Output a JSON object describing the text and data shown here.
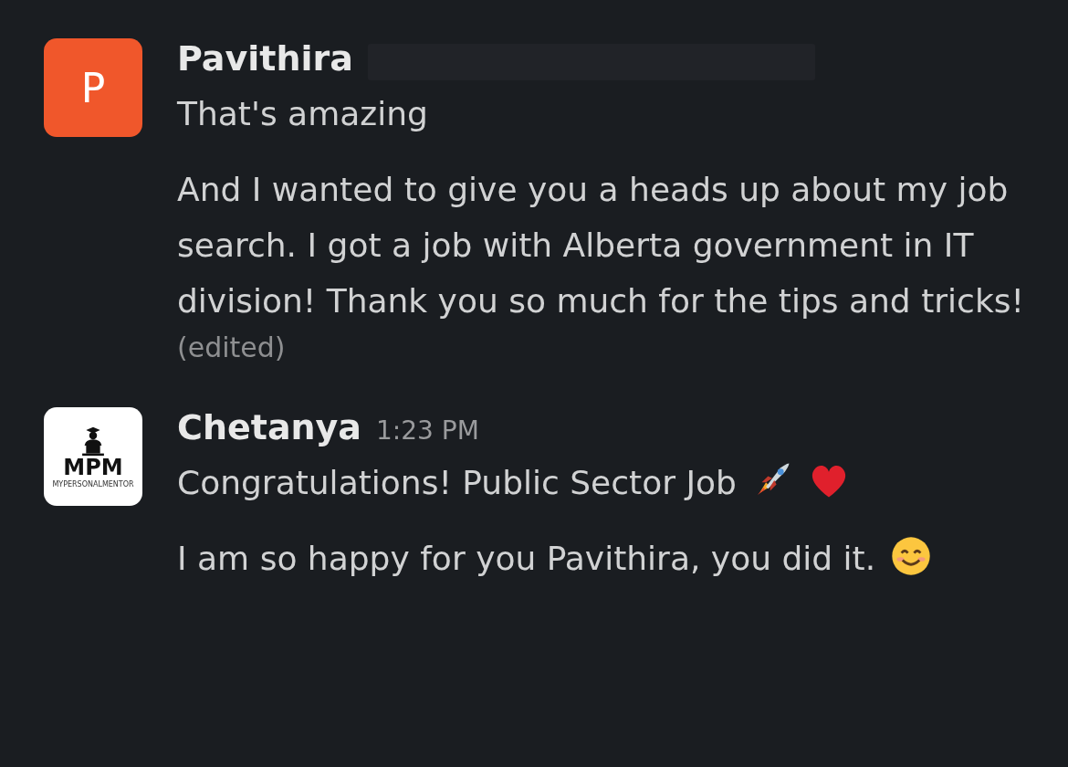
{
  "messages": [
    {
      "author": "Pavithira",
      "author_redacted_suffix": true,
      "avatar": {
        "kind": "letter",
        "letter": "P",
        "color": "#f0572b"
      },
      "paragraphs": [
        {
          "text": "That's amazing"
        },
        {
          "text": "And I wanted to give you a heads up about my job search. I got a job with Alberta government in IT division! Thank you so much for the tips and tricks!"
        }
      ],
      "edited": "(edited)"
    },
    {
      "author": "Chetanya",
      "time": "1:23 PM",
      "avatar": {
        "kind": "logo",
        "logo_text": "MPM",
        "logo_caption": "MYPERSONALMENTOR"
      },
      "paragraphs": [
        {
          "text": "Congratulations! Public Sector Job",
          "emojis": [
            {
              "kind": "rocket"
            },
            {
              "kind": "heart"
            }
          ]
        },
        {
          "text": "I am so happy for you Pavithira, you did it.",
          "emojis": [
            {
              "kind": "smile"
            }
          ]
        }
      ]
    }
  ]
}
